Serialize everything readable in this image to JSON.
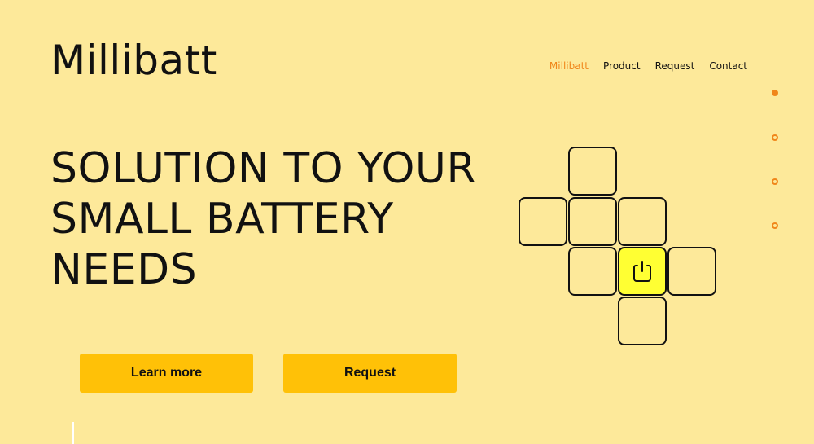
{
  "brand": {
    "name": "Millibatt"
  },
  "nav": {
    "items": [
      {
        "label": "Millibatt",
        "active": true
      },
      {
        "label": "Product",
        "active": false
      },
      {
        "label": "Request",
        "active": false
      },
      {
        "label": "Contact",
        "active": false
      }
    ]
  },
  "hero": {
    "headline_lines": [
      "SOLUTION TO YOUR",
      "SMALL BATTERY",
      "NEEDS"
    ],
    "learn_more_label": "Learn more",
    "request_label": "Request"
  },
  "section_indicator": {
    "count": 4,
    "active_index": 0
  },
  "graphic": {
    "center_icon": "power-icon"
  },
  "colors": {
    "background": "#fde99a",
    "accent": "#f0861a",
    "button": "#ffc107",
    "highlight_cell": "#ffff33",
    "text": "#111111"
  }
}
